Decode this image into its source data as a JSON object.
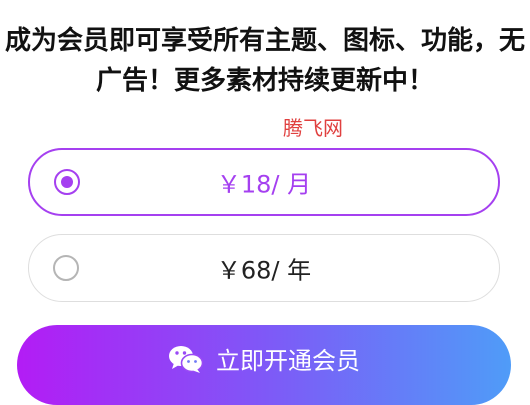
{
  "header": {
    "line1": "成为会员即可享受所有主题、图标、功能，无",
    "line2": "广告！更多素材持续更新中！"
  },
  "watermark": "腾飞网",
  "plans": [
    {
      "label": "￥18/ 月",
      "selected": true
    },
    {
      "label": "￥68/ 年",
      "selected": false
    }
  ],
  "cta": {
    "label": "立即开通会员",
    "icon": "wechat-icon"
  },
  "colors": {
    "accent": "#a540f0",
    "gradient_start": "#b31cf5",
    "gradient_end": "#4f9cf8",
    "watermark": "#e0403f"
  }
}
